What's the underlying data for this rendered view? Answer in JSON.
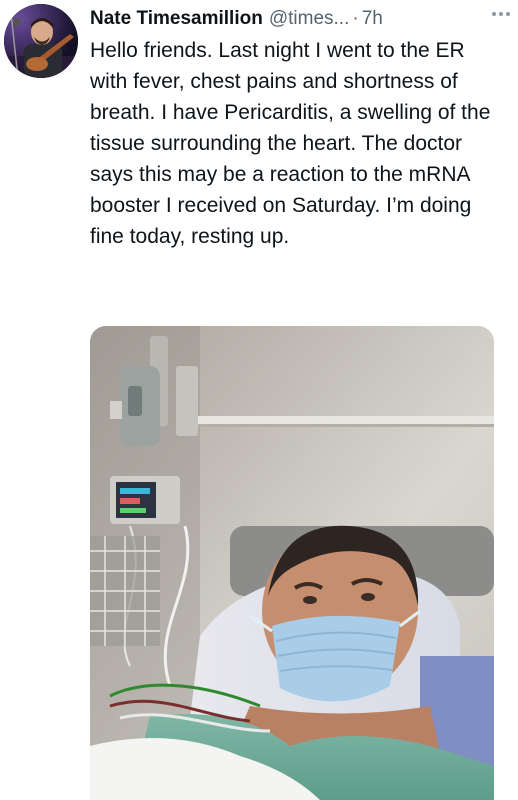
{
  "tweet": {
    "author_name": "Nate Timesamillion",
    "handle": "@times...",
    "separator": "·",
    "time": "7h",
    "more_label": "···",
    "text": "Hello friends. Last night I went to the ER with fever, chest pains and shortness of breath. I have Pericarditis, a swelling of the tissue surrounding the heart. The doctor says this may be a reaction to the mRNA booster I received on Saturday. I’m doing fine today, resting up."
  },
  "icons": {
    "more": "more-options-icon"
  }
}
